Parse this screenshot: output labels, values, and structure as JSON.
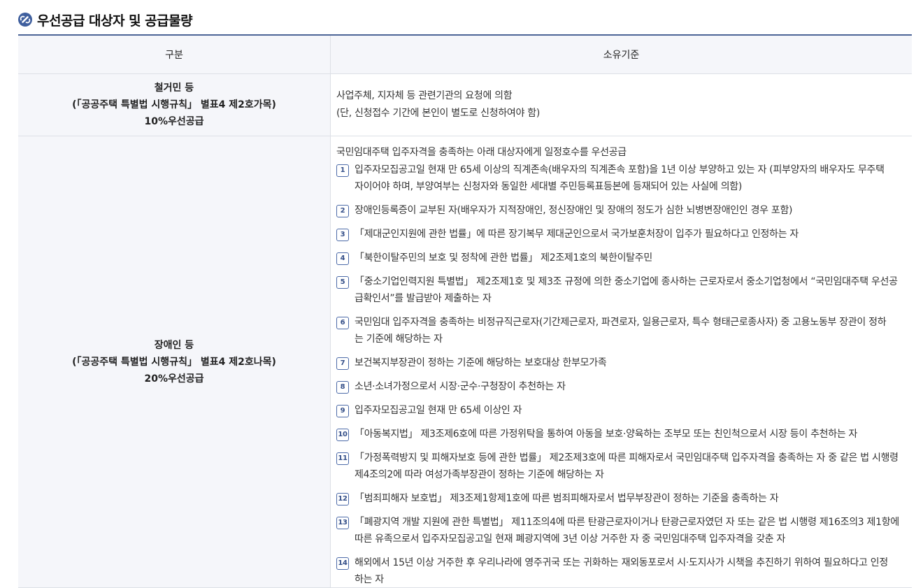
{
  "section_title": "우선공급 대상자 및 공급물량",
  "colors": {
    "accent": "#4c6496",
    "header_bg": "#f5f6fa",
    "border": "#dde0e6"
  },
  "table": {
    "headers": {
      "category": "구분",
      "criteria": "소유기준"
    },
    "rows": [
      {
        "category": [
          "철거민 등",
          "(「공공주택 특별법 시행규칙」 별표4 제2호가목)",
          "10%우선공급"
        ],
        "criteria_lines": [
          "사업주체, 지자체 등 관련기관의 요청에 의함",
          "(단, 신청접수 기간에 본인이 별도로 신청하여야 함)"
        ]
      },
      {
        "category": [
          "장애인 등",
          "(「공공주택 특별법 시행규칙」 별표4 제2호나목)",
          "20%우선공급"
        ],
        "intro": "국민임대주택 입주자격을 충족하는 아래 대상자에게 일정호수를 우선공급",
        "items": [
          {
            "num": "1",
            "lines": [
              "입주자모집공고일 현재 만 65세 이상의 직계존속(배우자의 직계존속 포함)을 1년 이상 부양하고 있는 자 (피부양자의 배우자도 무주택",
              "자이어야 하며, 부양여부는 신청자와 동일한 세대별 주민등록표등본에 등재되어 있는 사실에 의함)"
            ]
          },
          {
            "num": "2",
            "lines": [
              "장애인등록증이 교부된 자(배우자가 지적장애인, 정신장애인 및 장애의 정도가 심한 뇌병변장애인인 경우 포함)"
            ]
          },
          {
            "num": "3",
            "lines": [
              "「제대군인지원에 관한 법률」에 따른 장기복무 제대군인으로서 국가보훈처장이 입주가 필요하다고 인정하는 자"
            ]
          },
          {
            "num": "4",
            "lines": [
              "「북한이탈주민의 보호 및 정착에 관한 법률」 제2조제1호의 북한이탈주민"
            ]
          },
          {
            "num": "5",
            "lines": [
              "「중소기업인력지원 특별법」 제2조제1호 및 제3조 규정에 의한 중소기업에 종사하는 근로자로서 중소기업청에서 “국민임대주택 우선공",
              "급확인서”를 발급받아 제출하는 자"
            ]
          },
          {
            "num": "6",
            "lines": [
              "국민임대 입주자격을 충족하는 비정규직근로자(기간제근로자, 파견로자, 일용근로자, 특수 형태근로종사자) 중 고용노동부 장관이 정하",
              "는 기준에 해당하는 자"
            ]
          },
          {
            "num": "7",
            "lines": [
              "보건복지부장관이 정하는 기준에 해당하는 보호대상 한부모가족"
            ]
          },
          {
            "num": "8",
            "lines": [
              "소년·소녀가정으로서 시장·군수·구청장이 추천하는 자"
            ]
          },
          {
            "num": "9",
            "lines": [
              "입주자모집공고일 현재 만 65세 이상인 자"
            ]
          },
          {
            "num": "10",
            "lines": [
              "「아동복지법」 제3조제6호에 따른 가정위탁을 통하여 아동을 보호·양육하는 조부모 또는 친인척으로서 시장 등이 추천하는 자"
            ]
          },
          {
            "num": "11",
            "lines": [
              "「가정폭력방지 및 피해자보호 등에 관한 법률」 제2조제3호에 따른 피해자로서 국민임대주택 입주자격을 충족하는 자 중 같은 법 시행령",
              "제4조의2에 따라 여성가족부장관이 정하는 기준에 해당하는 자"
            ]
          },
          {
            "num": "12",
            "lines": [
              "「범죄피해자 보호법」 제3조제1항제1호에 따른 범죄피해자로서 법무부장관이 정하는 기준을 충족하는 자"
            ]
          },
          {
            "num": "13",
            "lines": [
              "「폐광지역 개발 지원에 관한 특별법」 제11조의4에 따른 탄광근로자이거나 탄광근로자였던 자 또는 같은 법 시행령 제16조의3 제1항에",
              "따른 유족으로서 입주자모집공고일 현재 폐광지역에 3년 이상 거주한 자 중 국민임대주택 입주자격을 갖춘 자"
            ]
          },
          {
            "num": "14",
            "lines": [
              "해외에서 15년 이상 거주한 후 우리나라에 영주귀국 또는 귀화하는 재외동포로서 시·도지사가 시책을 추진하기 위하여 필요하다고 인정",
              "하는 자"
            ]
          }
        ]
      }
    ]
  }
}
